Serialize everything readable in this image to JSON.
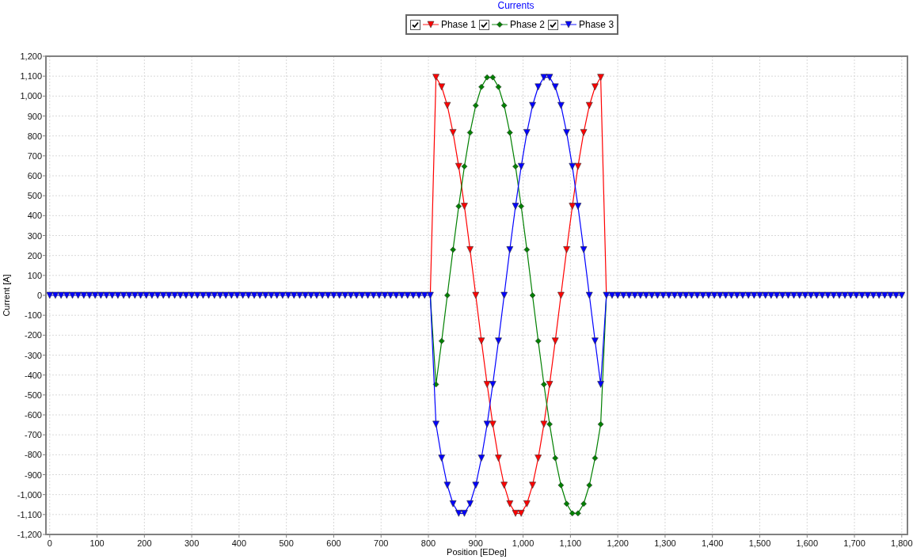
{
  "chart": {
    "legend": [
      {
        "checked": true
      },
      {
        "checked": true
      },
      {
        "checked": true
      }
    ],
    "chart_data": {
      "type": "line",
      "title": "Currents",
      "xlabel": "Position [EDeg]",
      "ylabel": "Current [A]",
      "grid": true,
      "legend": true,
      "xlim": [
        -8,
        1812
      ],
      "ylim": [
        -1200,
        1200
      ],
      "xticks": [
        0,
        100,
        200,
        300,
        400,
        500,
        600,
        700,
        800,
        900,
        {
          "value": 1000,
          "label": "1,000"
        },
        {
          "value": 1100,
          "label": "1,100"
        },
        {
          "value": 1200,
          "label": "1,200"
        },
        {
          "value": 1300,
          "label": "1,300"
        },
        {
          "value": 1400,
          "label": "1,400"
        },
        {
          "value": 1500,
          "label": "1,500"
        },
        {
          "value": 1600,
          "label": "1,600"
        },
        {
          "value": 1700,
          "label": "1,700"
        },
        {
          "value": 1800,
          "label": "1,800"
        }
      ],
      "yticks": [
        {
          "value": -1200,
          "label": "-1,200"
        },
        {
          "value": -1100,
          "label": "-1,100"
        },
        {
          "value": -1000,
          "label": "-1,000"
        },
        -900,
        -800,
        -700,
        -600,
        -500,
        -400,
        -300,
        -200,
        -100,
        0,
        100,
        200,
        300,
        400,
        500,
        600,
        700,
        800,
        900,
        {
          "value": 1000,
          "label": "1,000"
        },
        {
          "value": 1100,
          "label": "1,100"
        },
        {
          "value": 1200,
          "label": "1,200"
        }
      ],
      "x": [
        0,
        12,
        24,
        36,
        48,
        60,
        72,
        84,
        96,
        108,
        120,
        132,
        144,
        156,
        168,
        180,
        192,
        204,
        216,
        228,
        240,
        252,
        264,
        276,
        288,
        300,
        312,
        324,
        336,
        348,
        360,
        372,
        384,
        396,
        408,
        420,
        432,
        444,
        456,
        468,
        480,
        492,
        504,
        516,
        528,
        540,
        552,
        564,
        576,
        588,
        600,
        612,
        624,
        636,
        648,
        660,
        672,
        684,
        696,
        708,
        720,
        732,
        744,
        756,
        768,
        780,
        792,
        804,
        816,
        828,
        840,
        852,
        864,
        876,
        888,
        900,
        912,
        924,
        936,
        948,
        960,
        972,
        984,
        996,
        1008,
        1020,
        1032,
        1044,
        1056,
        1068,
        1080,
        1092,
        1104,
        1116,
        1128,
        1140,
        1152,
        1164,
        1176,
        1188,
        1200,
        1212,
        1224,
        1236,
        1248,
        1260,
        1272,
        1284,
        1296,
        1308,
        1320,
        1332,
        1344,
        1356,
        1368,
        1380,
        1392,
        1404,
        1416,
        1428,
        1440,
        1452,
        1464,
        1476,
        1488,
        1500,
        1512,
        1524,
        1536,
        1548,
        1560,
        1572,
        1584,
        1596,
        1608,
        1620,
        1632,
        1644,
        1656,
        1668,
        1680,
        1692,
        1704,
        1716,
        1728,
        1740,
        1752,
        1764,
        1776,
        1788,
        1800
      ],
      "series": [
        {
          "name": "Phase 1",
          "color": "#ff0000",
          "marker": "triangle",
          "values": [
            null,
            null,
            null,
            null,
            null,
            null,
            null,
            null,
            null,
            null,
            null,
            null,
            null,
            null,
            null,
            null,
            null,
            null,
            null,
            null,
            null,
            null,
            null,
            null,
            null,
            null,
            null,
            null,
            null,
            null,
            null,
            null,
            null,
            null,
            null,
            null,
            null,
            null,
            null,
            null,
            null,
            null,
            null,
            null,
            null,
            null,
            null,
            null,
            null,
            null,
            null,
            null,
            null,
            null,
            null,
            null,
            null,
            null,
            null,
            null,
            null,
            null,
            null,
            null,
            null,
            null,
            null,
            0,
            1094,
            1046,
            953,
            817,
            647,
            447,
            229,
            0,
            -229,
            -447,
            -647,
            -817,
            -953,
            -1046,
            -1094,
            -1094,
            -1046,
            -953,
            -817,
            -647,
            -447,
            -229,
            0,
            229,
            447,
            647,
            817,
            953,
            1046,
            1094,
            0,
            null,
            null,
            null,
            null,
            null,
            null,
            null,
            null,
            null,
            null,
            null,
            null,
            null,
            null,
            null,
            null,
            null,
            null,
            null,
            null,
            null,
            null,
            null,
            null,
            null,
            null,
            null,
            null,
            null,
            null,
            null,
            null,
            null,
            null,
            null,
            null,
            null,
            null,
            null,
            null,
            null,
            null,
            null,
            null,
            null,
            null,
            null,
            null,
            null,
            null,
            null,
            null
          ]
        },
        {
          "name": "Phase 2",
          "color": "#008000",
          "marker": "diamond",
          "values": [
            null,
            null,
            null,
            null,
            null,
            null,
            null,
            null,
            null,
            null,
            null,
            null,
            null,
            null,
            null,
            null,
            null,
            null,
            null,
            null,
            null,
            null,
            null,
            null,
            null,
            null,
            null,
            null,
            null,
            null,
            null,
            null,
            null,
            null,
            null,
            null,
            null,
            null,
            null,
            null,
            null,
            null,
            null,
            null,
            null,
            null,
            null,
            null,
            null,
            null,
            null,
            null,
            null,
            null,
            null,
            null,
            null,
            null,
            null,
            null,
            null,
            null,
            null,
            null,
            null,
            null,
            null,
            0,
            -447,
            -229,
            0,
            229,
            447,
            647,
            817,
            953,
            1046,
            1094,
            1094,
            1046,
            953,
            817,
            647,
            447,
            229,
            0,
            -229,
            -447,
            -647,
            -817,
            -953,
            -1046,
            -1094,
            -1094,
            -1046,
            -953,
            -817,
            -647,
            0,
            null,
            null,
            null,
            null,
            null,
            null,
            null,
            null,
            null,
            null,
            null,
            null,
            null,
            null,
            null,
            null,
            null,
            null,
            null,
            null,
            null,
            null,
            null,
            null,
            null,
            null,
            null,
            null,
            null,
            null,
            null,
            null,
            null,
            null,
            null,
            null,
            null,
            null,
            null,
            null,
            null,
            null,
            null,
            null,
            null,
            null,
            null,
            null,
            null,
            null,
            null,
            null
          ]
        },
        {
          "name": "Phase 3",
          "color": "#0000ff",
          "marker": "triangle",
          "values": [
            0,
            0,
            0,
            0,
            0,
            0,
            0,
            0,
            0,
            0,
            0,
            0,
            0,
            0,
            0,
            0,
            0,
            0,
            0,
            0,
            0,
            0,
            0,
            0,
            0,
            0,
            0,
            0,
            0,
            0,
            0,
            0,
            0,
            0,
            0,
            0,
            0,
            0,
            0,
            0,
            0,
            0,
            0,
            0,
            0,
            0,
            0,
            0,
            0,
            0,
            0,
            0,
            0,
            0,
            0,
            0,
            0,
            0,
            0,
            0,
            0,
            0,
            0,
            0,
            0,
            0,
            0,
            0,
            -647,
            -817,
            -953,
            -1046,
            -1094,
            -1094,
            -1046,
            -953,
            -817,
            -647,
            -447,
            -229,
            0,
            229,
            447,
            647,
            817,
            953,
            1046,
            1094,
            1094,
            1046,
            953,
            817,
            647,
            447,
            229,
            0,
            -229,
            -447,
            0,
            0,
            0,
            0,
            0,
            0,
            0,
            0,
            0,
            0,
            0,
            0,
            0,
            0,
            0,
            0,
            0,
            0,
            0,
            0,
            0,
            0,
            0,
            0,
            0,
            0,
            0,
            0,
            0,
            0,
            0,
            0,
            0,
            0,
            0,
            0,
            0,
            0,
            0,
            0,
            0,
            0,
            0,
            0,
            0,
            0,
            0,
            0,
            0,
            0,
            0,
            0,
            0
          ]
        }
      ]
    }
  }
}
